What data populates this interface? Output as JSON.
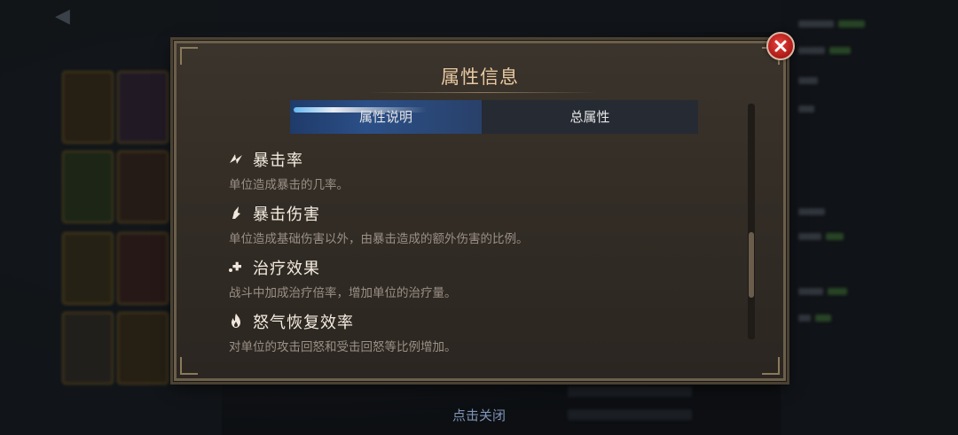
{
  "modal": {
    "title": "属性信息",
    "tabs": [
      {
        "label": "属性说明",
        "active": true
      },
      {
        "label": "总属性",
        "active": false
      }
    ],
    "items": [
      {
        "name": "暴击率",
        "desc": "单位造成暴击的几率。",
        "icon": "crit-rate-icon"
      },
      {
        "name": "暴击伤害",
        "desc": "单位造成基础伤害以外，由暴击造成的额外伤害的比例。",
        "icon": "crit-damage-icon"
      },
      {
        "name": "治疗效果",
        "desc": "战斗中加成治疗倍率，增加单位的治疗量。",
        "icon": "heal-icon"
      },
      {
        "name": "怒气恢复效率",
        "desc": "对单位的攻击回怒和受击回怒等比例增加。",
        "icon": "rage-icon"
      }
    ],
    "close_hint": "点击关闭"
  },
  "colors": {
    "title": "#e8c9a0",
    "active_tab": "#2b4f87",
    "close_button": "#d42a22",
    "hint": "#7e94b8"
  }
}
